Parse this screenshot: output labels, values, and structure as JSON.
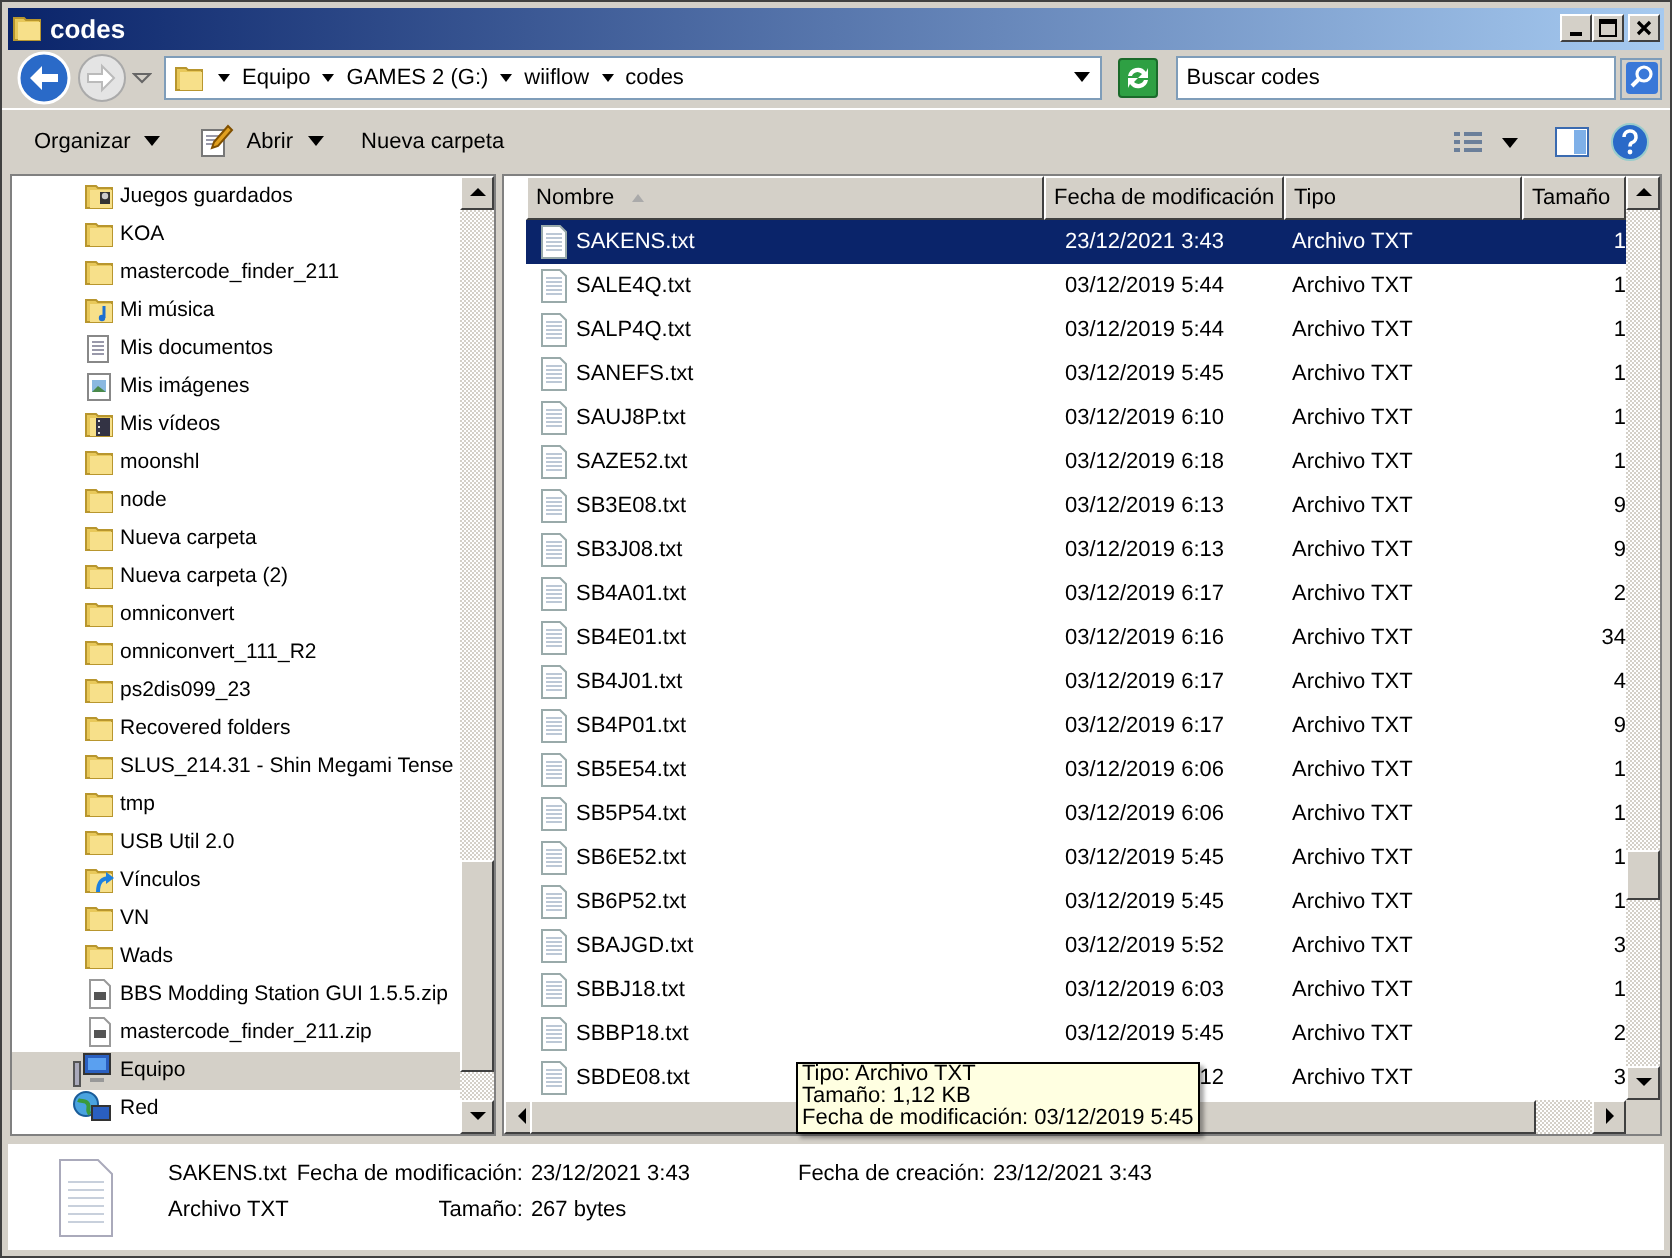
{
  "window": {
    "title": "codes"
  },
  "address": {
    "path": [
      "Equipo",
      "GAMES 2 (G:)",
      "wiiflow",
      "codes"
    ],
    "search": {
      "placeholder": "Buscar codes"
    }
  },
  "toolbar": {
    "items": [
      {
        "label": "Organizar",
        "kind": "menu"
      },
      {
        "label": "Abrir",
        "kind": "open"
      },
      {
        "label": "Nueva carpeta",
        "kind": "plain"
      }
    ]
  },
  "sidebar": {
    "items": [
      {
        "label": "Juegos guardados",
        "kind": "saved-games",
        "selected": false
      },
      {
        "label": "KOA",
        "kind": "folder",
        "selected": false
      },
      {
        "label": "mastercode_finder_211",
        "kind": "folder",
        "selected": false
      },
      {
        "label": "Mi música",
        "kind": "music",
        "selected": false
      },
      {
        "label": "Mis documentos",
        "kind": "documents",
        "selected": false
      },
      {
        "label": "Mis imágenes",
        "kind": "pictures",
        "selected": false
      },
      {
        "label": "Mis vídeos",
        "kind": "videos",
        "selected": false
      },
      {
        "label": "moonshl",
        "kind": "folder",
        "selected": false
      },
      {
        "label": "node",
        "kind": "folder",
        "selected": false
      },
      {
        "label": "Nueva carpeta",
        "kind": "folder",
        "selected": false
      },
      {
        "label": "Nueva carpeta (2)",
        "kind": "folder",
        "selected": false
      },
      {
        "label": "omniconvert",
        "kind": "folder",
        "selected": false
      },
      {
        "label": "omniconvert_111_R2",
        "kind": "folder",
        "selected": false
      },
      {
        "label": "ps2dis099_23",
        "kind": "folder",
        "selected": false
      },
      {
        "label": "Recovered folders",
        "kind": "folder",
        "selected": false
      },
      {
        "label": "SLUS_214.31 - Shin Megami Tense",
        "kind": "folder",
        "selected": false
      },
      {
        "label": "tmp",
        "kind": "folder",
        "selected": false
      },
      {
        "label": "USB Util 2.0",
        "kind": "folder",
        "selected": false
      },
      {
        "label": "Vínculos",
        "kind": "links",
        "selected": false
      },
      {
        "label": "VN",
        "kind": "folder",
        "selected": false
      },
      {
        "label": "Wads",
        "kind": "folder",
        "selected": false
      },
      {
        "label": "BBS Modding Station GUI 1.5.5.zip",
        "kind": "zip",
        "selected": false
      },
      {
        "label": "mastercode_finder_211.zip",
        "kind": "zip",
        "selected": false
      },
      {
        "label": "Equipo",
        "kind": "computer",
        "selected": true
      },
      {
        "label": "Red",
        "kind": "network",
        "selected": false
      }
    ]
  },
  "file_list": {
    "columns": [
      {
        "label": "Nombre",
        "sorted": true
      },
      {
        "label": "Fecha de modificación",
        "sorted": false
      },
      {
        "label": "Tipo",
        "sorted": false
      },
      {
        "label": "Tamaño",
        "sorted": false
      }
    ],
    "rows": [
      {
        "name": "SAKENS.txt",
        "modified": "23/12/2021 3:43",
        "type": "Archivo TXT",
        "size": "1",
        "selected": true
      },
      {
        "name": "SALE4Q.txt",
        "modified": "03/12/2019 5:44",
        "type": "Archivo TXT",
        "size": "1",
        "selected": false
      },
      {
        "name": "SALP4Q.txt",
        "modified": "03/12/2019 5:44",
        "type": "Archivo TXT",
        "size": "1",
        "selected": false
      },
      {
        "name": "SANEFS.txt",
        "modified": "03/12/2019 5:45",
        "type": "Archivo TXT",
        "size": "1",
        "selected": false
      },
      {
        "name": "SAUJ8P.txt",
        "modified": "03/12/2019 6:10",
        "type": "Archivo TXT",
        "size": "1",
        "selected": false
      },
      {
        "name": "SAZE52.txt",
        "modified": "03/12/2019 6:18",
        "type": "Archivo TXT",
        "size": "1",
        "selected": false
      },
      {
        "name": "SB3E08.txt",
        "modified": "03/12/2019 6:13",
        "type": "Archivo TXT",
        "size": "9",
        "selected": false
      },
      {
        "name": "SB3J08.txt",
        "modified": "03/12/2019 6:13",
        "type": "Archivo TXT",
        "size": "9",
        "selected": false
      },
      {
        "name": "SB4A01.txt",
        "modified": "03/12/2019 6:17",
        "type": "Archivo TXT",
        "size": "2",
        "selected": false
      },
      {
        "name": "SB4E01.txt",
        "modified": "03/12/2019 6:16",
        "type": "Archivo TXT",
        "size": "34",
        "selected": false
      },
      {
        "name": "SB4J01.txt",
        "modified": "03/12/2019 6:17",
        "type": "Archivo TXT",
        "size": "4",
        "selected": false
      },
      {
        "name": "SB4P01.txt",
        "modified": "03/12/2019 6:17",
        "type": "Archivo TXT",
        "size": "9",
        "selected": false
      },
      {
        "name": "SB5E54.txt",
        "modified": "03/12/2019 6:06",
        "type": "Archivo TXT",
        "size": "1",
        "selected": false
      },
      {
        "name": "SB5P54.txt",
        "modified": "03/12/2019 6:06",
        "type": "Archivo TXT",
        "size": "1",
        "selected": false
      },
      {
        "name": "SB6E52.txt",
        "modified": "03/12/2019 5:45",
        "type": "Archivo TXT",
        "size": "1",
        "selected": false
      },
      {
        "name": "SB6P52.txt",
        "modified": "03/12/2019 5:45",
        "type": "Archivo TXT",
        "size": "1",
        "selected": false
      },
      {
        "name": "SBAJGD.txt",
        "modified": "03/12/2019 5:52",
        "type": "Archivo TXT",
        "size": "3",
        "selected": false
      },
      {
        "name": "SBBJ18.txt",
        "modified": "03/12/2019 6:03",
        "type": "Archivo TXT",
        "size": "1",
        "selected": false
      },
      {
        "name": "SBBP18.txt",
        "modified": "03/12/2019 5:45",
        "type": "Archivo TXT",
        "size": "2",
        "selected": false
      },
      {
        "name": "SBDE08.txt",
        "modified": "12",
        "type": "Archivo TXT",
        "size": "3",
        "selected": false
      }
    ]
  },
  "tooltip": {
    "lines": [
      "Tipo: Archivo TXT",
      "Tamaño: 1,12 KB",
      "Fecha de modificación: 03/12/2019 5:45"
    ]
  },
  "details": {
    "name": "SAKENS.txt",
    "type": "Archivo TXT",
    "fields": [
      {
        "label": "Fecha de modificación:",
        "value": "23/12/2021 3:43"
      },
      {
        "label": "Tamaño:",
        "value": "267 bytes"
      },
      {
        "label": "Fecha de creación:",
        "value": "23/12/2021 3:43"
      }
    ]
  }
}
